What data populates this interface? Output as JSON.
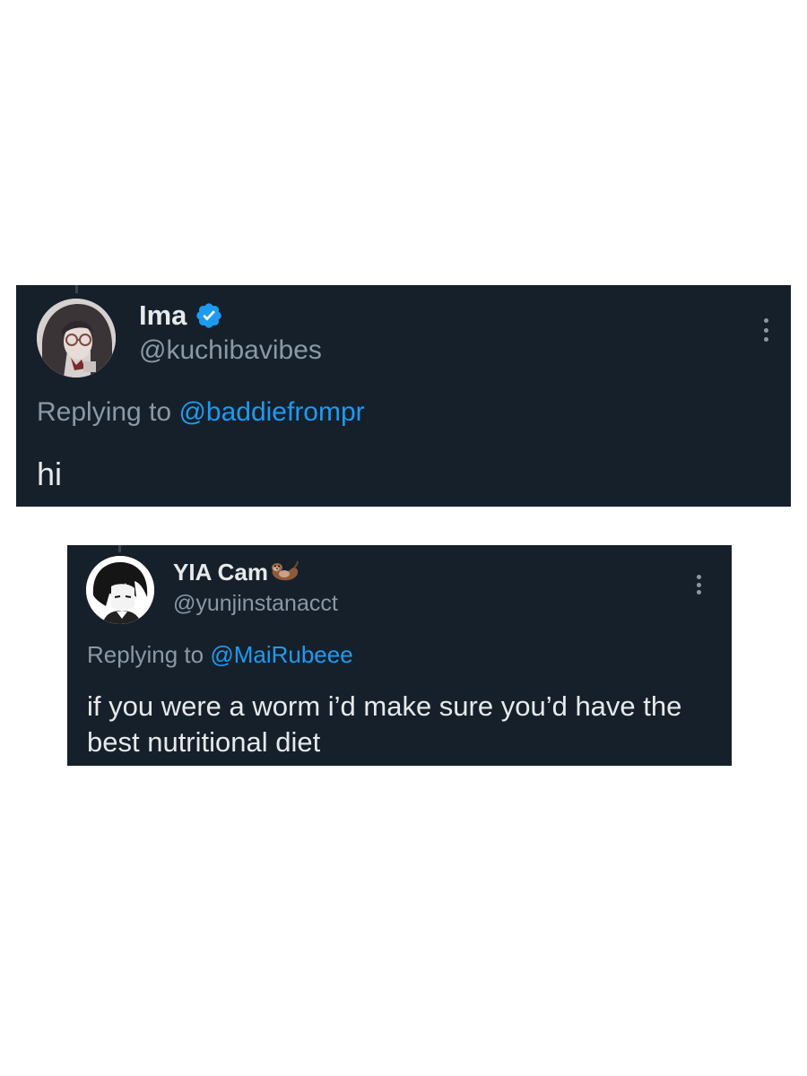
{
  "tweets": [
    {
      "display_name": "Ima",
      "handle": "@kuchibavibes",
      "verified": true,
      "replying_prefix": "Replying to",
      "replying_to": "@baddiefrompr",
      "text": "hi",
      "avatar_icon": "avatar-photo-icon",
      "badge_icon": "verified-badge-icon",
      "menu_icon": "more-options-icon"
    },
    {
      "display_name": "YIA Cam",
      "handle": "@yunjinstanacct",
      "verified": false,
      "name_emoji_icon": "otter-emoji-icon",
      "replying_prefix": "Replying to",
      "replying_to": "@MaiRubeee",
      "text": "if you were a worm i’d make sure you’d have the best nutritional diet",
      "avatar_icon": "avatar-manga-icon",
      "menu_icon": "more-options-icon"
    }
  ],
  "colors": {
    "card_background": "#15202b",
    "primary_text": "#e7e9ea",
    "secondary_text": "#8b98a5",
    "link_blue": "#1d9bf0",
    "verified_blue": "#1d9bf0",
    "page_background": "#ffffff"
  }
}
